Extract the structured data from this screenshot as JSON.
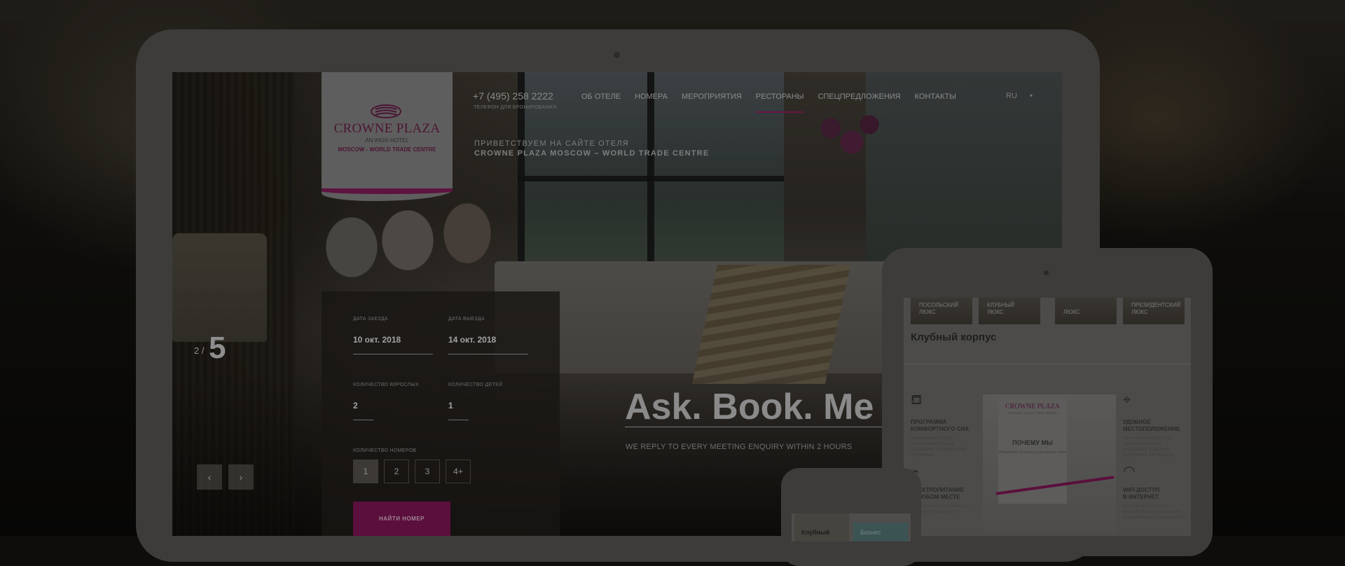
{
  "site": {
    "logo_title": "CROWNE PLAZA",
    "logo_sub": "AN IHG® HOTEL",
    "logo_location": "MOSCOW - WORLD TRADE CENTRE",
    "accent": "#6b1346"
  },
  "header": {
    "phone": "+7 (495) 258 2222",
    "phone_caption": "ТЕЛЕФОН ДЛЯ БРОНИРОВАНИЯ",
    "nav": [
      "ОБ ОТЕЛЕ",
      "НОМЕРА",
      "МЕРОПРИЯТИЯ",
      "РЕСТОРАНЫ",
      "СПЕЦПРЕДЛОЖЕНИЯ",
      "КОНТАКТЫ"
    ],
    "active_nav": "РЕСТОРАНЫ",
    "language": "RU",
    "greeting_line1": "ПРИВЕТСТВУЕМ НА САЙТЕ ОТЕЛЯ",
    "greeting_line2": "CROWNE PLAZA MOSCOW – WORLD TRADE CENTRE"
  },
  "booking": {
    "checkin_label": "ДАТА ЗАЕЗДА",
    "checkin_value": "10 окт. 2018",
    "checkout_label": "ДАТА ВЫЕЗДА",
    "checkout_value": "14 окт. 2018",
    "adults_label": "КОЛИЧЕСТВО ВЗРОСЛЫХ",
    "adults_value": "2",
    "children_label": "КОЛИЧЕСТВО ДЕТЕЙ",
    "children_value": "1",
    "rooms_label": "КОЛИЧЕСТВО НОМЕРОВ",
    "rooms_options": [
      "1",
      "2",
      "3",
      "4+"
    ],
    "rooms_selected": "1",
    "submit_label": "НАЙТИ НОМЕР"
  },
  "slider": {
    "current": "2",
    "separator": "/",
    "total": "5",
    "prev_icon": "chevron-left-icon",
    "next_icon": "chevron-right-icon",
    "prev_glyph": "‹",
    "next_glyph": "›"
  },
  "hero": {
    "title": "Ask. Book. Me",
    "subtitle": "WE REPLY TO EVERY MEETING ENQUIRY WITHIN 2 HOURS"
  },
  "tablet": {
    "categories": [
      {
        "line1": "ПОСОЛЬСКИЙ",
        "line2": "ЛЮКС"
      },
      {
        "line1": "КЛУБНЫЙ",
        "line2": "ЛЮКС"
      },
      {
        "line1": "",
        "line2": "ЛЮКС"
      },
      {
        "line1": "ПРЕЗИДЕНТСКИЙ",
        "line2": "ЛЮКС"
      }
    ],
    "section_title": "Клубный корпус",
    "features": [
      {
        "title1": "ПРОГРАММА",
        "title2": "КОМФОРТНОГО СНА",
        "desc": "Комплексный подход к полноценному отдыху, созданному при отдельному требованию",
        "icon": "bed-icon",
        "glyph": "⛾"
      },
      {
        "title1": "УДОБНОЕ",
        "title2": "МЕСТОПОЛОЖЕНИЕ",
        "desc": "Наш отель находится на Краснопресненской набережной, в шаговой доступности Экспоцентра",
        "icon": "location-pin-icon",
        "glyph": "⌖"
      },
      {
        "title1": "ЭЛЕКТРОПИТАНИЕ",
        "title2": "В ЛЮБОМ МЕСТЕ",
        "desc": "Подключение там удобно при времени и любом месте",
        "icon": "plug-icon",
        "glyph": "⌁"
      },
      {
        "title1": "WIFI ДОСТУП",
        "title2": "В ИНТЕРНЕТ",
        "desc": "Беспроводной доступ в интернет без дополнительной платы на всей территории отеля",
        "icon": "wifi-icon",
        "glyph": "◠"
      }
    ],
    "poster_logo": "CROWNE PLAZA",
    "poster_sub": "MOSCOW - WORLD TRADE CENTRE",
    "poster_heading": "ПОЧЕМУ МЫ",
    "poster_text": "Попробуйте лучшие услуги нашего отеля"
  },
  "mobile": {
    "tab1": "Клубный",
    "tab2": "Бизнес"
  }
}
